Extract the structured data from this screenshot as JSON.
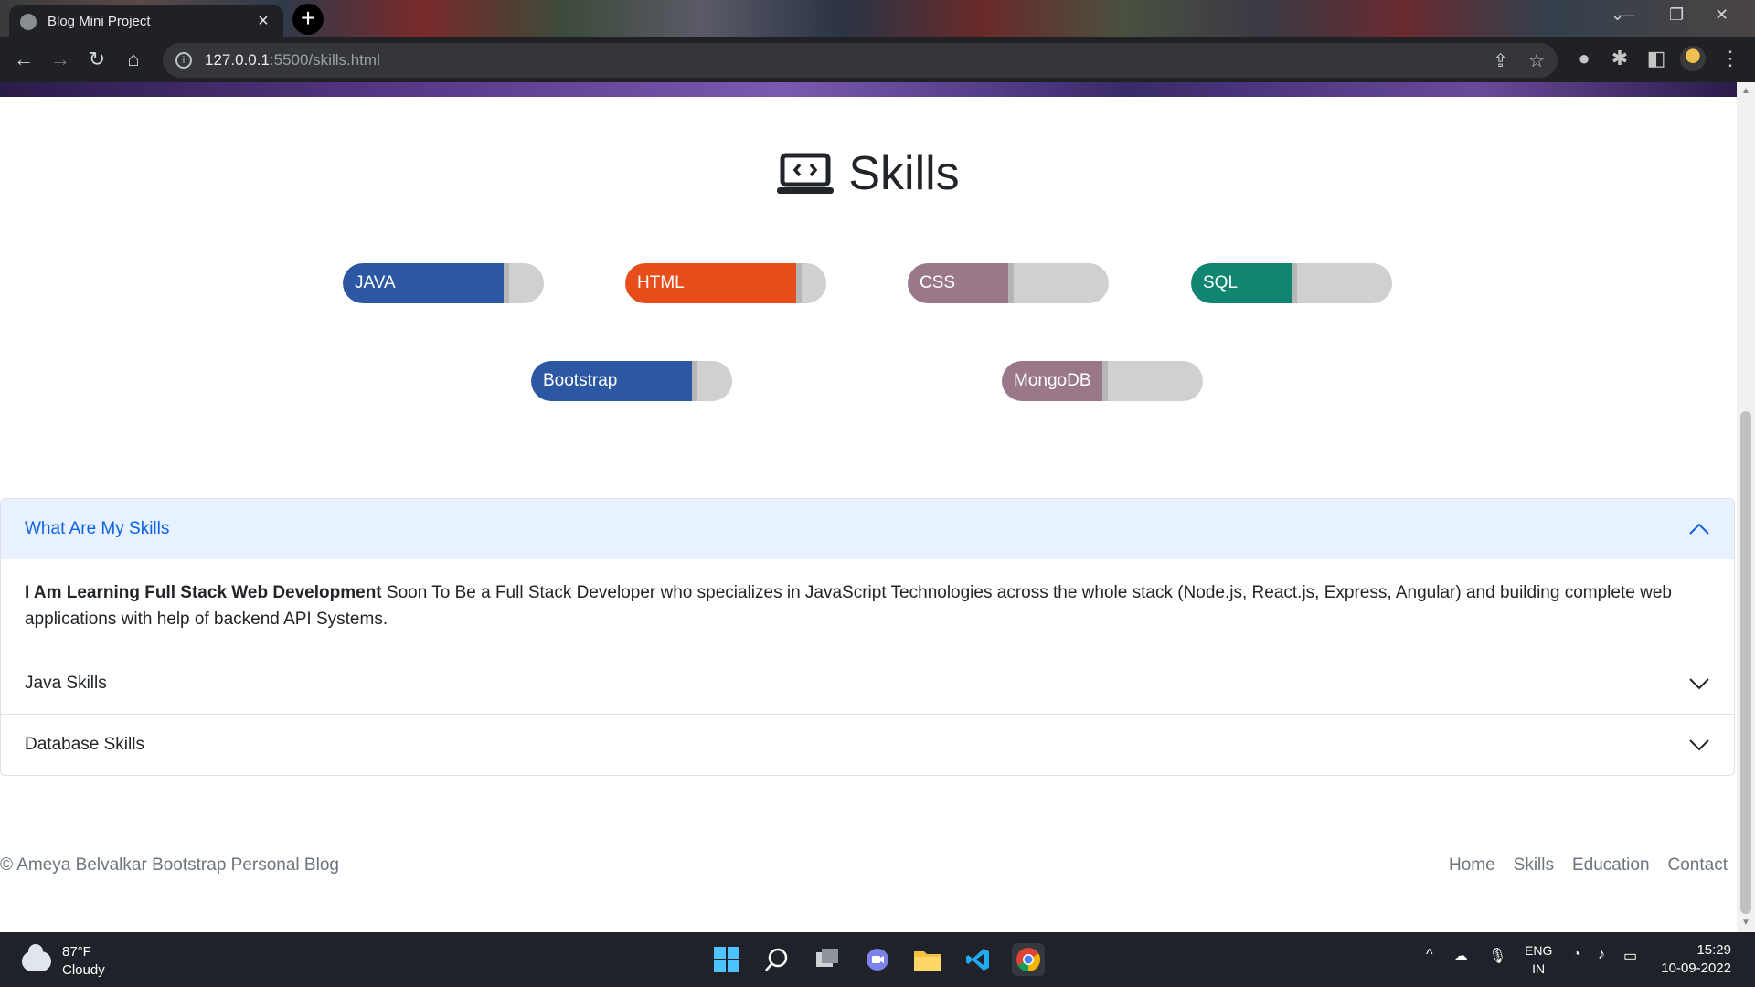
{
  "browser": {
    "tab_title": "Blog Mini Project",
    "url_host": "127.0.0.1",
    "url_path": ":5500/skills.html"
  },
  "page": {
    "heading": "Skills",
    "skills": [
      {
        "name": "JAVA",
        "level": 0.8,
        "color": "#2b57a3"
      },
      {
        "name": "HTML",
        "level": 0.85,
        "color": "#e84e1c"
      },
      {
        "name": "CSS",
        "level": 0.5,
        "color": "#9a7889"
      },
      {
        "name": "SQL",
        "level": 0.5,
        "color": "#108672"
      },
      {
        "name": "Bootstrap",
        "level": 0.8,
        "color": "#2b57a3"
      },
      {
        "name": "MongoDB",
        "level": 0.5,
        "color": "#9a7889"
      }
    ],
    "accordion": {
      "item1_title": "What Are My Skills",
      "item1_bold": "I Am Learning Full Stack Web Development",
      "item1_text": " Soon To Be a Full Stack Developer who specializes in JavaScript Technologies across the whole stack (Node.js, React.js, Express, Angular) and building complete web applications with help of backend API Systems.",
      "item2_title": "Java Skills",
      "item3_title": "Database Skills"
    },
    "footer": {
      "copyright": "© Ameya Belvalkar Bootstrap Personal Blog",
      "nav": [
        "Home",
        "Skills",
        "Education",
        "Contact"
      ]
    }
  },
  "taskbar": {
    "temperature": "87°F",
    "condition": "Cloudy",
    "lang1": "ENG",
    "lang2": "IN",
    "time": "15:29",
    "date": "10-09-2022"
  }
}
